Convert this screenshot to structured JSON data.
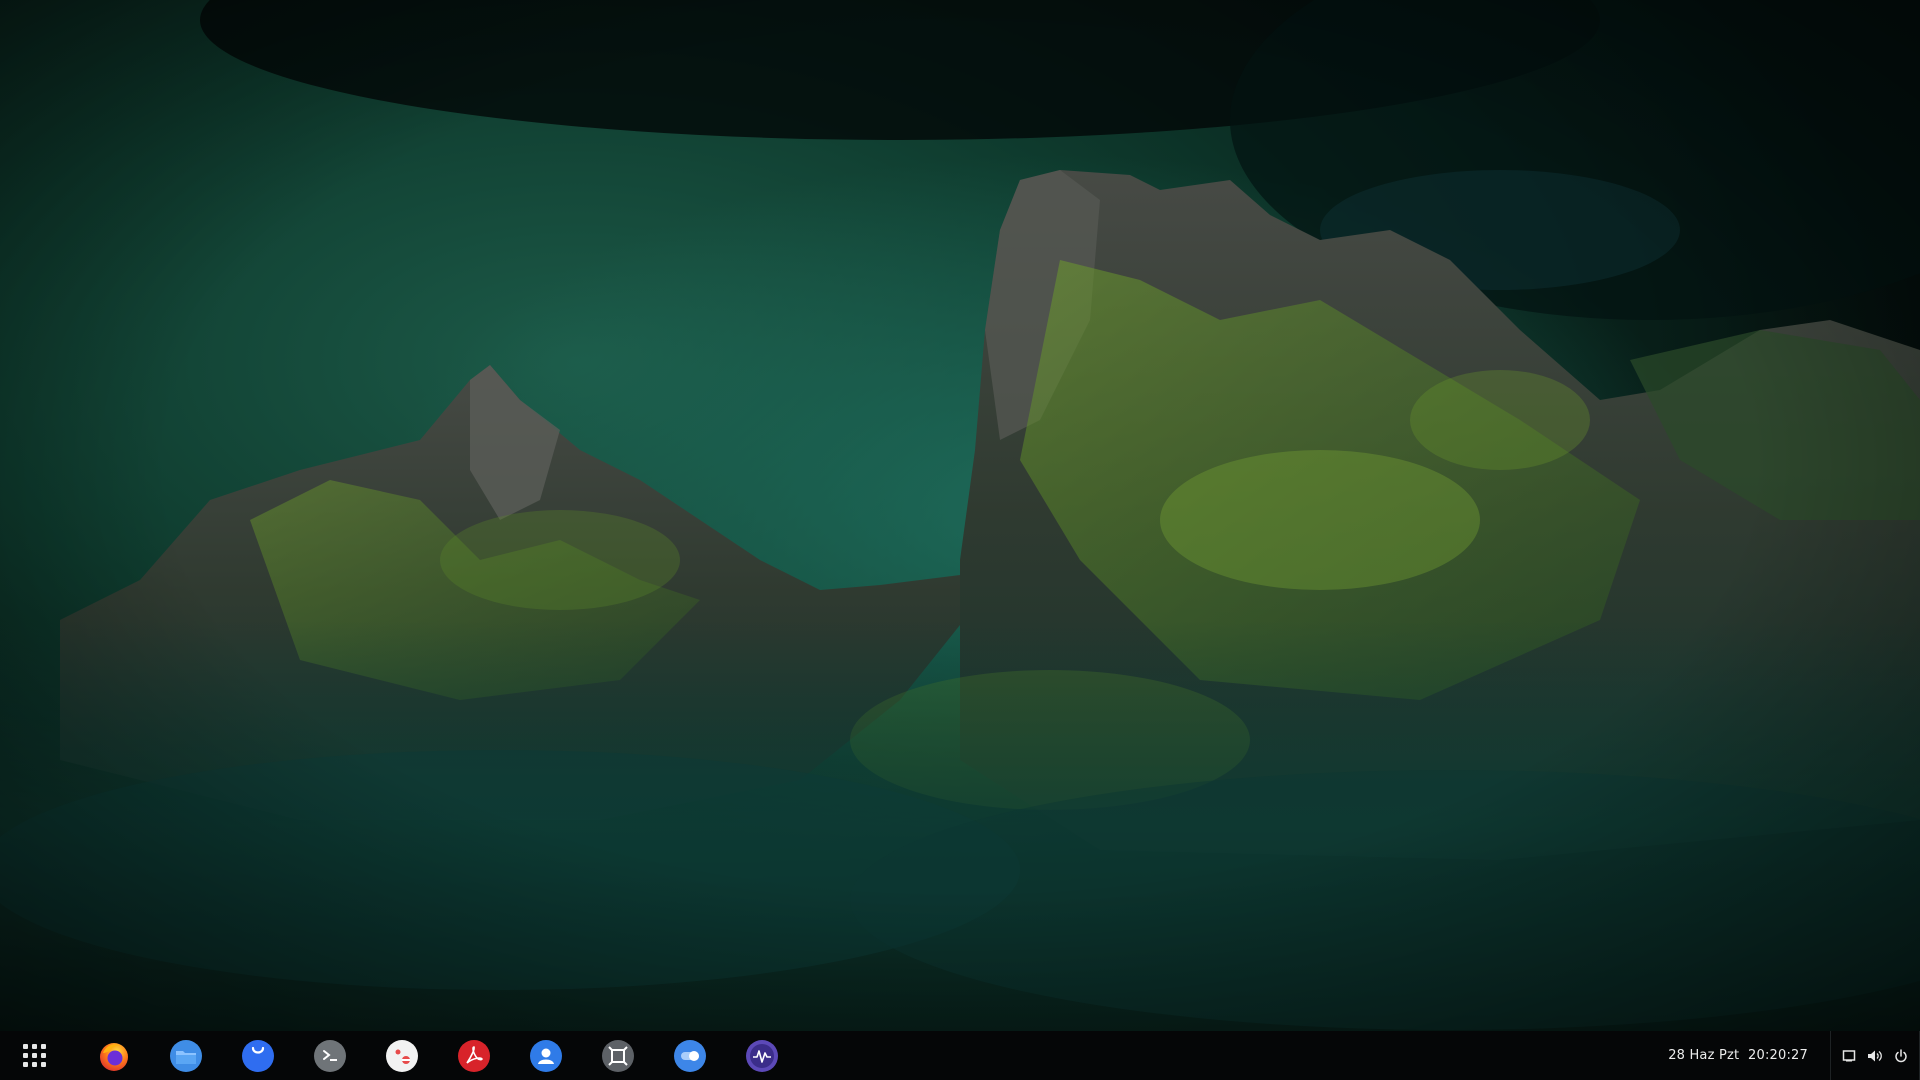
{
  "desktop": {
    "wallpaper": {
      "description_icon": "mossy-mountain-wallpaper",
      "sky_color": "#0b2a22",
      "rock_color": "#3a3d38",
      "moss_color": "#5f8f2a"
    }
  },
  "taskbar": {
    "background": "#050607",
    "launcher_icon": "app-grid-icon",
    "apps": [
      {
        "name": "Firefox",
        "icon": "firefox-icon"
      },
      {
        "name": "Files",
        "icon": "files-folder-icon"
      },
      {
        "name": "Software Store",
        "icon": "store-bag-icon"
      },
      {
        "name": "Terminal",
        "icon": "terminal-icon"
      },
      {
        "name": "Settings",
        "icon": "settings-toggle-icon"
      },
      {
        "name": "PDF Viewer",
        "icon": "pdf-icon"
      },
      {
        "name": "Users",
        "icon": "users-icon"
      },
      {
        "name": "Screenshot",
        "icon": "screenshot-icon"
      },
      {
        "name": "Toggle App",
        "icon": "toggle-switch-icon"
      },
      {
        "name": "System Monitor",
        "icon": "system-monitor-icon"
      }
    ],
    "clock": {
      "date": "28 Haz Pzt",
      "time": "20:20:27"
    },
    "tray": {
      "icons": [
        "show-desktop-icon",
        "volume-icon",
        "power-icon"
      ]
    }
  }
}
